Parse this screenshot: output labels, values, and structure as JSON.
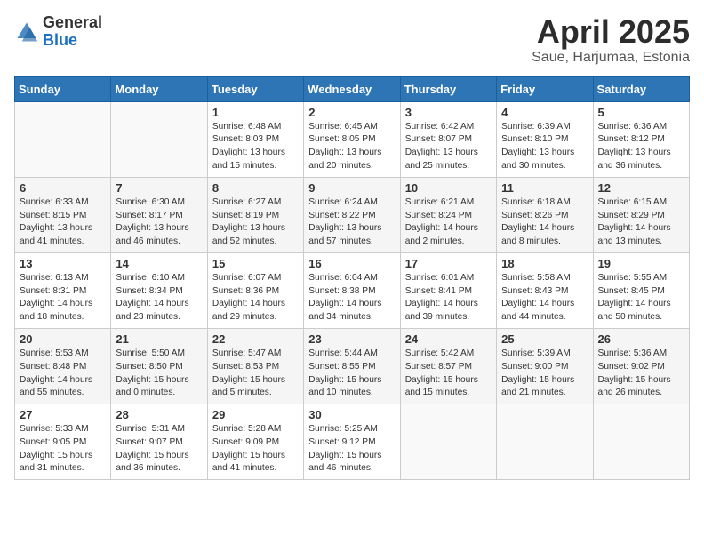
{
  "header": {
    "logo_general": "General",
    "logo_blue": "Blue",
    "title": "April 2025",
    "location": "Saue, Harjumaa, Estonia"
  },
  "weekdays": [
    "Sunday",
    "Monday",
    "Tuesday",
    "Wednesday",
    "Thursday",
    "Friday",
    "Saturday"
  ],
  "weeks": [
    [
      {
        "day": "",
        "detail": ""
      },
      {
        "day": "",
        "detail": ""
      },
      {
        "day": "1",
        "detail": "Sunrise: 6:48 AM\nSunset: 8:03 PM\nDaylight: 13 hours and 15 minutes."
      },
      {
        "day": "2",
        "detail": "Sunrise: 6:45 AM\nSunset: 8:05 PM\nDaylight: 13 hours and 20 minutes."
      },
      {
        "day": "3",
        "detail": "Sunrise: 6:42 AM\nSunset: 8:07 PM\nDaylight: 13 hours and 25 minutes."
      },
      {
        "day": "4",
        "detail": "Sunrise: 6:39 AM\nSunset: 8:10 PM\nDaylight: 13 hours and 30 minutes."
      },
      {
        "day": "5",
        "detail": "Sunrise: 6:36 AM\nSunset: 8:12 PM\nDaylight: 13 hours and 36 minutes."
      }
    ],
    [
      {
        "day": "6",
        "detail": "Sunrise: 6:33 AM\nSunset: 8:15 PM\nDaylight: 13 hours and 41 minutes."
      },
      {
        "day": "7",
        "detail": "Sunrise: 6:30 AM\nSunset: 8:17 PM\nDaylight: 13 hours and 46 minutes."
      },
      {
        "day": "8",
        "detail": "Sunrise: 6:27 AM\nSunset: 8:19 PM\nDaylight: 13 hours and 52 minutes."
      },
      {
        "day": "9",
        "detail": "Sunrise: 6:24 AM\nSunset: 8:22 PM\nDaylight: 13 hours and 57 minutes."
      },
      {
        "day": "10",
        "detail": "Sunrise: 6:21 AM\nSunset: 8:24 PM\nDaylight: 14 hours and 2 minutes."
      },
      {
        "day": "11",
        "detail": "Sunrise: 6:18 AM\nSunset: 8:26 PM\nDaylight: 14 hours and 8 minutes."
      },
      {
        "day": "12",
        "detail": "Sunrise: 6:15 AM\nSunset: 8:29 PM\nDaylight: 14 hours and 13 minutes."
      }
    ],
    [
      {
        "day": "13",
        "detail": "Sunrise: 6:13 AM\nSunset: 8:31 PM\nDaylight: 14 hours and 18 minutes."
      },
      {
        "day": "14",
        "detail": "Sunrise: 6:10 AM\nSunset: 8:34 PM\nDaylight: 14 hours and 23 minutes."
      },
      {
        "day": "15",
        "detail": "Sunrise: 6:07 AM\nSunset: 8:36 PM\nDaylight: 14 hours and 29 minutes."
      },
      {
        "day": "16",
        "detail": "Sunrise: 6:04 AM\nSunset: 8:38 PM\nDaylight: 14 hours and 34 minutes."
      },
      {
        "day": "17",
        "detail": "Sunrise: 6:01 AM\nSunset: 8:41 PM\nDaylight: 14 hours and 39 minutes."
      },
      {
        "day": "18",
        "detail": "Sunrise: 5:58 AM\nSunset: 8:43 PM\nDaylight: 14 hours and 44 minutes."
      },
      {
        "day": "19",
        "detail": "Sunrise: 5:55 AM\nSunset: 8:45 PM\nDaylight: 14 hours and 50 minutes."
      }
    ],
    [
      {
        "day": "20",
        "detail": "Sunrise: 5:53 AM\nSunset: 8:48 PM\nDaylight: 14 hours and 55 minutes."
      },
      {
        "day": "21",
        "detail": "Sunrise: 5:50 AM\nSunset: 8:50 PM\nDaylight: 15 hours and 0 minutes."
      },
      {
        "day": "22",
        "detail": "Sunrise: 5:47 AM\nSunset: 8:53 PM\nDaylight: 15 hours and 5 minutes."
      },
      {
        "day": "23",
        "detail": "Sunrise: 5:44 AM\nSunset: 8:55 PM\nDaylight: 15 hours and 10 minutes."
      },
      {
        "day": "24",
        "detail": "Sunrise: 5:42 AM\nSunset: 8:57 PM\nDaylight: 15 hours and 15 minutes."
      },
      {
        "day": "25",
        "detail": "Sunrise: 5:39 AM\nSunset: 9:00 PM\nDaylight: 15 hours and 21 minutes."
      },
      {
        "day": "26",
        "detail": "Sunrise: 5:36 AM\nSunset: 9:02 PM\nDaylight: 15 hours and 26 minutes."
      }
    ],
    [
      {
        "day": "27",
        "detail": "Sunrise: 5:33 AM\nSunset: 9:05 PM\nDaylight: 15 hours and 31 minutes."
      },
      {
        "day": "28",
        "detail": "Sunrise: 5:31 AM\nSunset: 9:07 PM\nDaylight: 15 hours and 36 minutes."
      },
      {
        "day": "29",
        "detail": "Sunrise: 5:28 AM\nSunset: 9:09 PM\nDaylight: 15 hours and 41 minutes."
      },
      {
        "day": "30",
        "detail": "Sunrise: 5:25 AM\nSunset: 9:12 PM\nDaylight: 15 hours and 46 minutes."
      },
      {
        "day": "",
        "detail": ""
      },
      {
        "day": "",
        "detail": ""
      },
      {
        "day": "",
        "detail": ""
      }
    ]
  ]
}
